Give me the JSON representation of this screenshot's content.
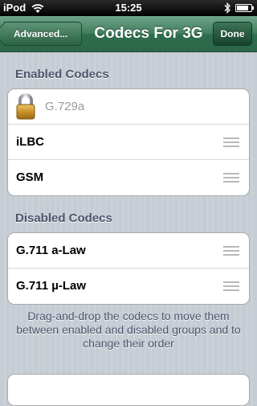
{
  "status_bar": {
    "carrier": "iPod",
    "time": "15:25",
    "battery_level": 0.85
  },
  "nav": {
    "back_label": "Advanced...",
    "title": "Codecs For 3G",
    "done_label": "Done"
  },
  "enabled_section": {
    "header": "Enabled Codecs",
    "items": [
      {
        "label": "G.729a",
        "locked": true
      },
      {
        "label": "iLBC",
        "locked": false
      },
      {
        "label": "GSM",
        "locked": false
      }
    ]
  },
  "disabled_section": {
    "header": "Disabled Codecs",
    "items": [
      {
        "label": "G.711 a-Law"
      },
      {
        "label": "G.711 µ-Law"
      }
    ]
  },
  "footer_text": "Drag-and-drop the codecs to move them between enabled and disabled groups and to change their order",
  "colors": {
    "nav_green": "#3f7c5e",
    "section_header": "#4c566c",
    "locked_text": "#9b9b9b"
  }
}
